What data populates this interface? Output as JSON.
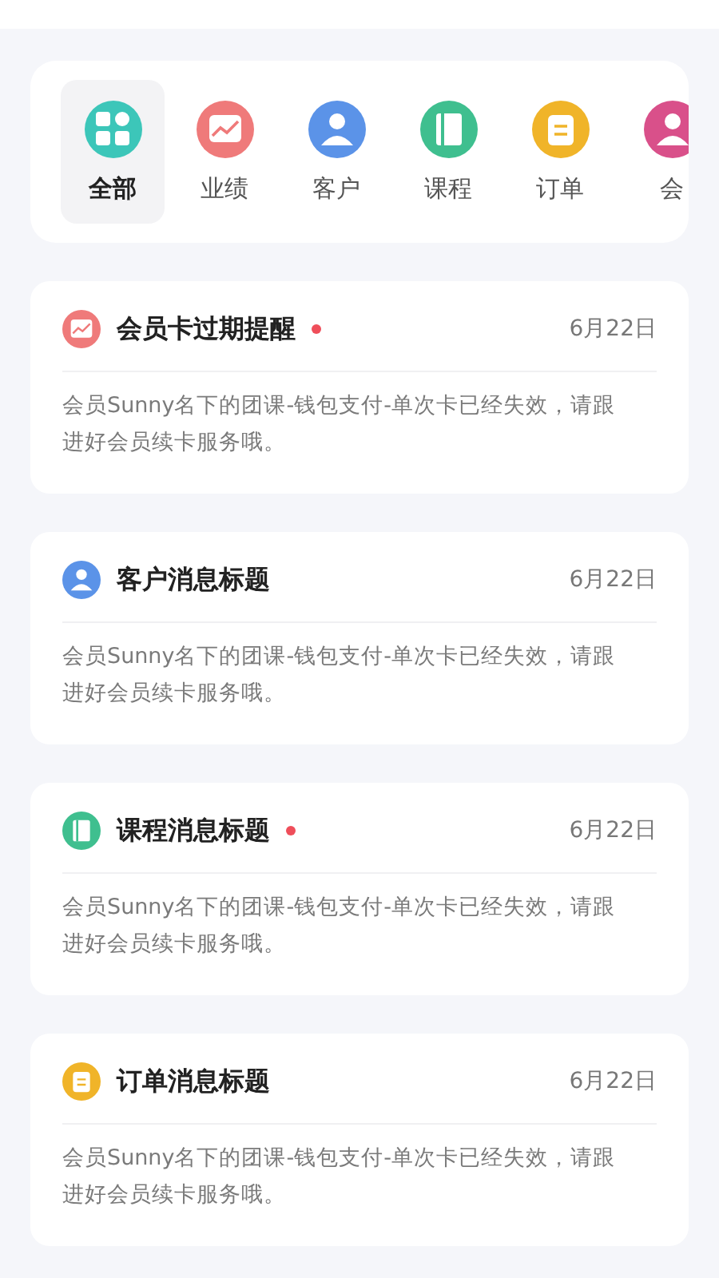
{
  "categories": [
    {
      "label": "全部",
      "kind": "grid",
      "color": "#3cc6b9",
      "selected": true
    },
    {
      "label": "业绩",
      "kind": "chart",
      "color": "#ef7a7a",
      "selected": false
    },
    {
      "label": "客户",
      "kind": "person",
      "color": "#5b93e8",
      "selected": false
    },
    {
      "label": "课程",
      "kind": "book",
      "color": "#3fbf8f",
      "selected": false
    },
    {
      "label": "订单",
      "kind": "note",
      "color": "#f0b429",
      "selected": false
    },
    {
      "label": "会",
      "kind": "person",
      "color": "#d9508a",
      "selected": false
    }
  ],
  "messages": [
    {
      "kind": "chart",
      "color": "#ef7a7a",
      "title": "会员卡过期提醒",
      "unread": true,
      "date": "6月22日",
      "body": "会员Sunny名下的团课-钱包支付-单次卡已经失效，请跟进好会员续卡服务哦。"
    },
    {
      "kind": "person",
      "color": "#5b93e8",
      "title": "客户消息标题",
      "unread": false,
      "date": "6月22日",
      "body": "会员Sunny名下的团课-钱包支付-单次卡已经失效，请跟进好会员续卡服务哦。"
    },
    {
      "kind": "book",
      "color": "#3fbf8f",
      "title": "课程消息标题",
      "unread": true,
      "date": "6月22日",
      "body": "会员Sunny名下的团课-钱包支付-单次卡已经失效，请跟进好会员续卡服务哦。"
    },
    {
      "kind": "note",
      "color": "#f0b429",
      "title": "订单消息标题",
      "unread": false,
      "date": "6月22日",
      "body": "会员Sunny名下的团课-钱包支付-单次卡已经失效，请跟进好会员续卡服务哦。"
    }
  ]
}
